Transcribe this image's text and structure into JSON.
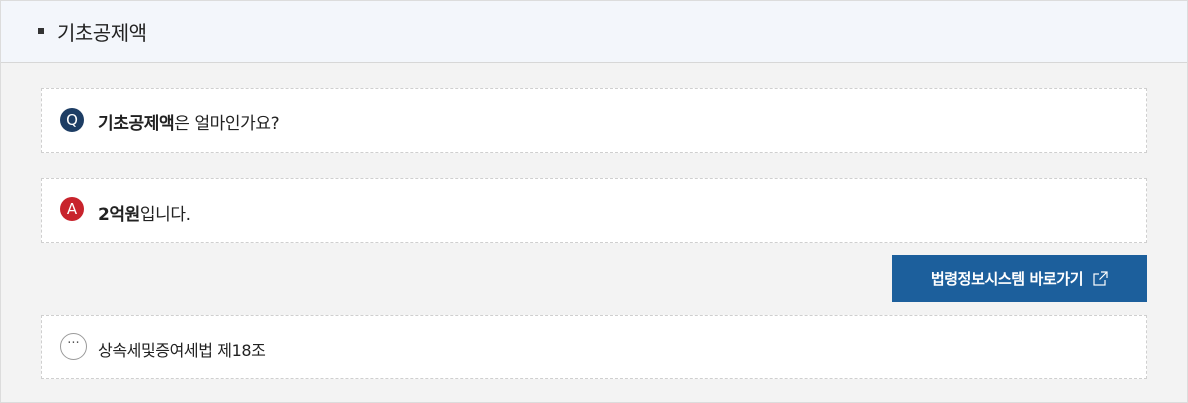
{
  "header": {
    "title": "기초공제액"
  },
  "question": {
    "badge": "Q",
    "bold": "기초공제액",
    "rest": "은 얼마인가요?"
  },
  "answer": {
    "badge": "A",
    "bold": "2억원",
    "rest": "입니다."
  },
  "law_button": {
    "label": "법령정보시스템 바로가기",
    "icon": "external-link-icon"
  },
  "reference": {
    "badge": "···",
    "text": "상속세및증여세법 제18조"
  },
  "colors": {
    "question_badge": "#1d3d64",
    "answer_badge": "#c8232c",
    "button": "#1c5f9c"
  }
}
